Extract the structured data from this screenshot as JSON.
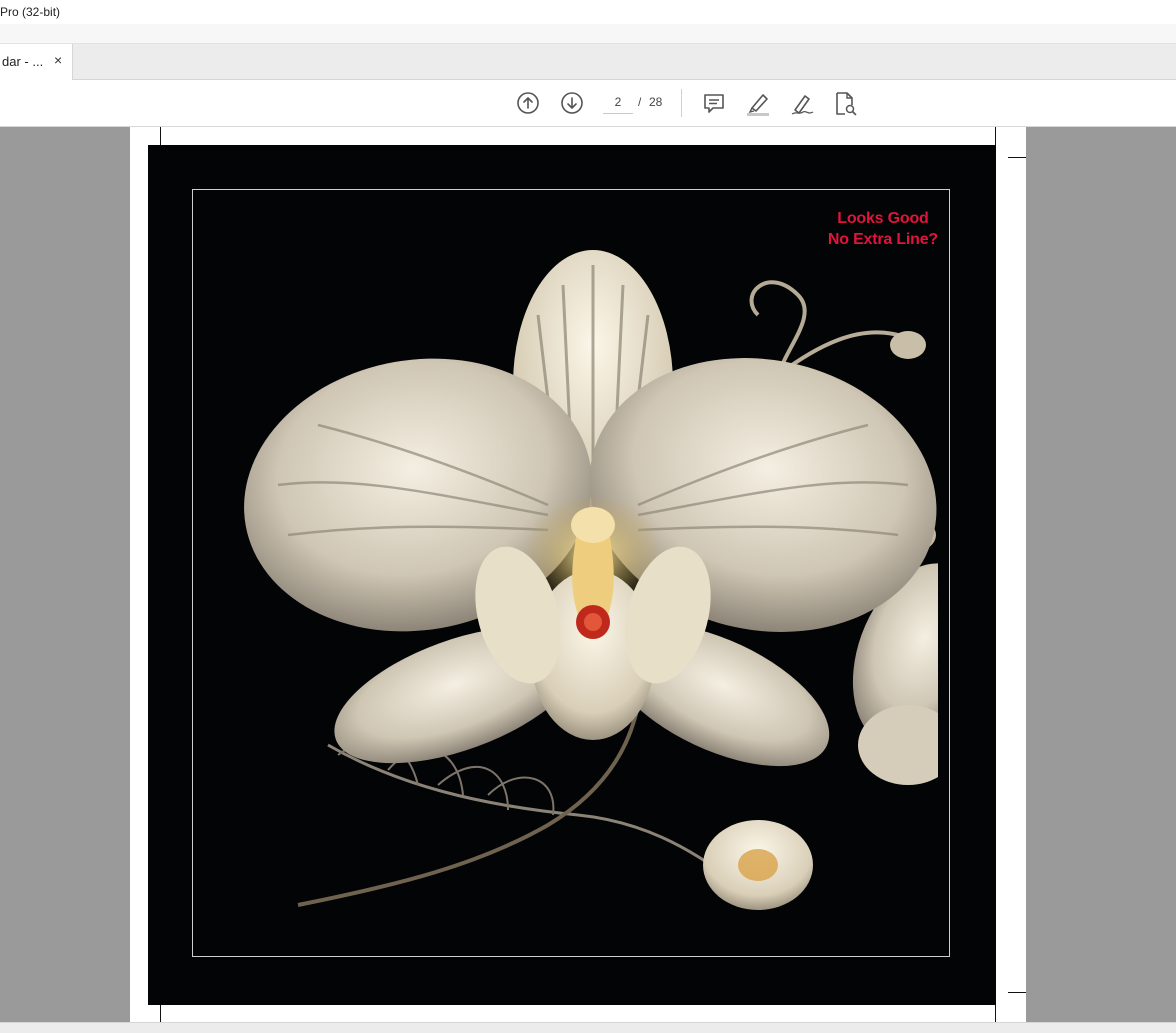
{
  "window": {
    "title_fragment": "Pro (32-bit)"
  },
  "tab": {
    "label": "dar - ...",
    "close_glyph": "×"
  },
  "toolbar": {
    "current_page": "2",
    "separator": "/",
    "total_pages": "28",
    "icons": [
      "arrow-up-circle-icon",
      "arrow-down-circle-icon",
      "comment-icon",
      "highlighter-icon",
      "pen-sign-icon",
      "page-zoom-icon"
    ]
  },
  "document": {
    "annotation_line1": "Looks Good",
    "annotation_line2": "No Extra Line?",
    "annotation_color": "#e0143c",
    "artwork": "white orchid on black background"
  },
  "colors": {
    "viewer_bg": "#9a9a9a",
    "page_bg": "#ffffff",
    "artwork_bg": "#030405"
  }
}
